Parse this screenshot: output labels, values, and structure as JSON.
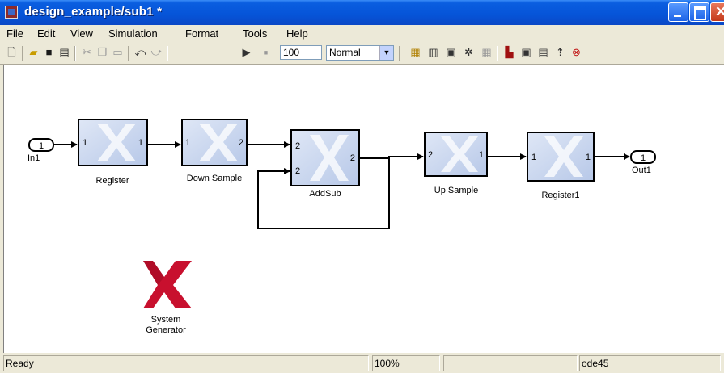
{
  "window": {
    "title": "design_example/sub1 *"
  },
  "menu": [
    "File",
    "Edit",
    "View",
    "Simulation",
    "Format",
    "Tools",
    "Help"
  ],
  "toolbar": {
    "tools": [
      "new-icon",
      "open-icon",
      "save-icon",
      "print-icon",
      "cut-icon",
      "copy-icon",
      "paste-icon",
      "undo-icon",
      "redo-icon",
      "start-icon",
      "stop-icon",
      "build-icon",
      "library-icon",
      "update-icon",
      "debug-icon",
      "explorer-icon",
      "model-browser-icon",
      "block-diagram-icon",
      "parent-icon",
      "stop-sign-icon"
    ],
    "stop_time": "100",
    "sim_mode": "Normal"
  },
  "diagram": {
    "inport": {
      "number": "1",
      "label": "In1"
    },
    "outport": {
      "number": "1",
      "label": "Out1"
    },
    "blocks": [
      {
        "name": "Register",
        "in_ports": [
          "1"
        ],
        "out_ports": [
          "1"
        ]
      },
      {
        "name": "Down Sample",
        "in_ports": [
          "1"
        ],
        "out_ports": [
          "2"
        ]
      },
      {
        "name": "AddSub",
        "in_ports": [
          "2",
          "2"
        ],
        "out_ports": [
          "2"
        ]
      },
      {
        "name": "Up Sample",
        "in_ports": [
          "2"
        ],
        "out_ports": [
          "1"
        ]
      },
      {
        "name": "Register1",
        "in_ports": [
          "1"
        ],
        "out_ports": [
          "1"
        ]
      }
    ],
    "system_generator": {
      "line1": "System",
      "line2": "Generator"
    }
  },
  "status": {
    "state": "Ready",
    "zoom": "100%",
    "solver": "ode45"
  },
  "colors": {
    "titlebar": "#0654d8",
    "block_fill": "#c5d3ec",
    "xilinx_red": "#c8102e"
  }
}
